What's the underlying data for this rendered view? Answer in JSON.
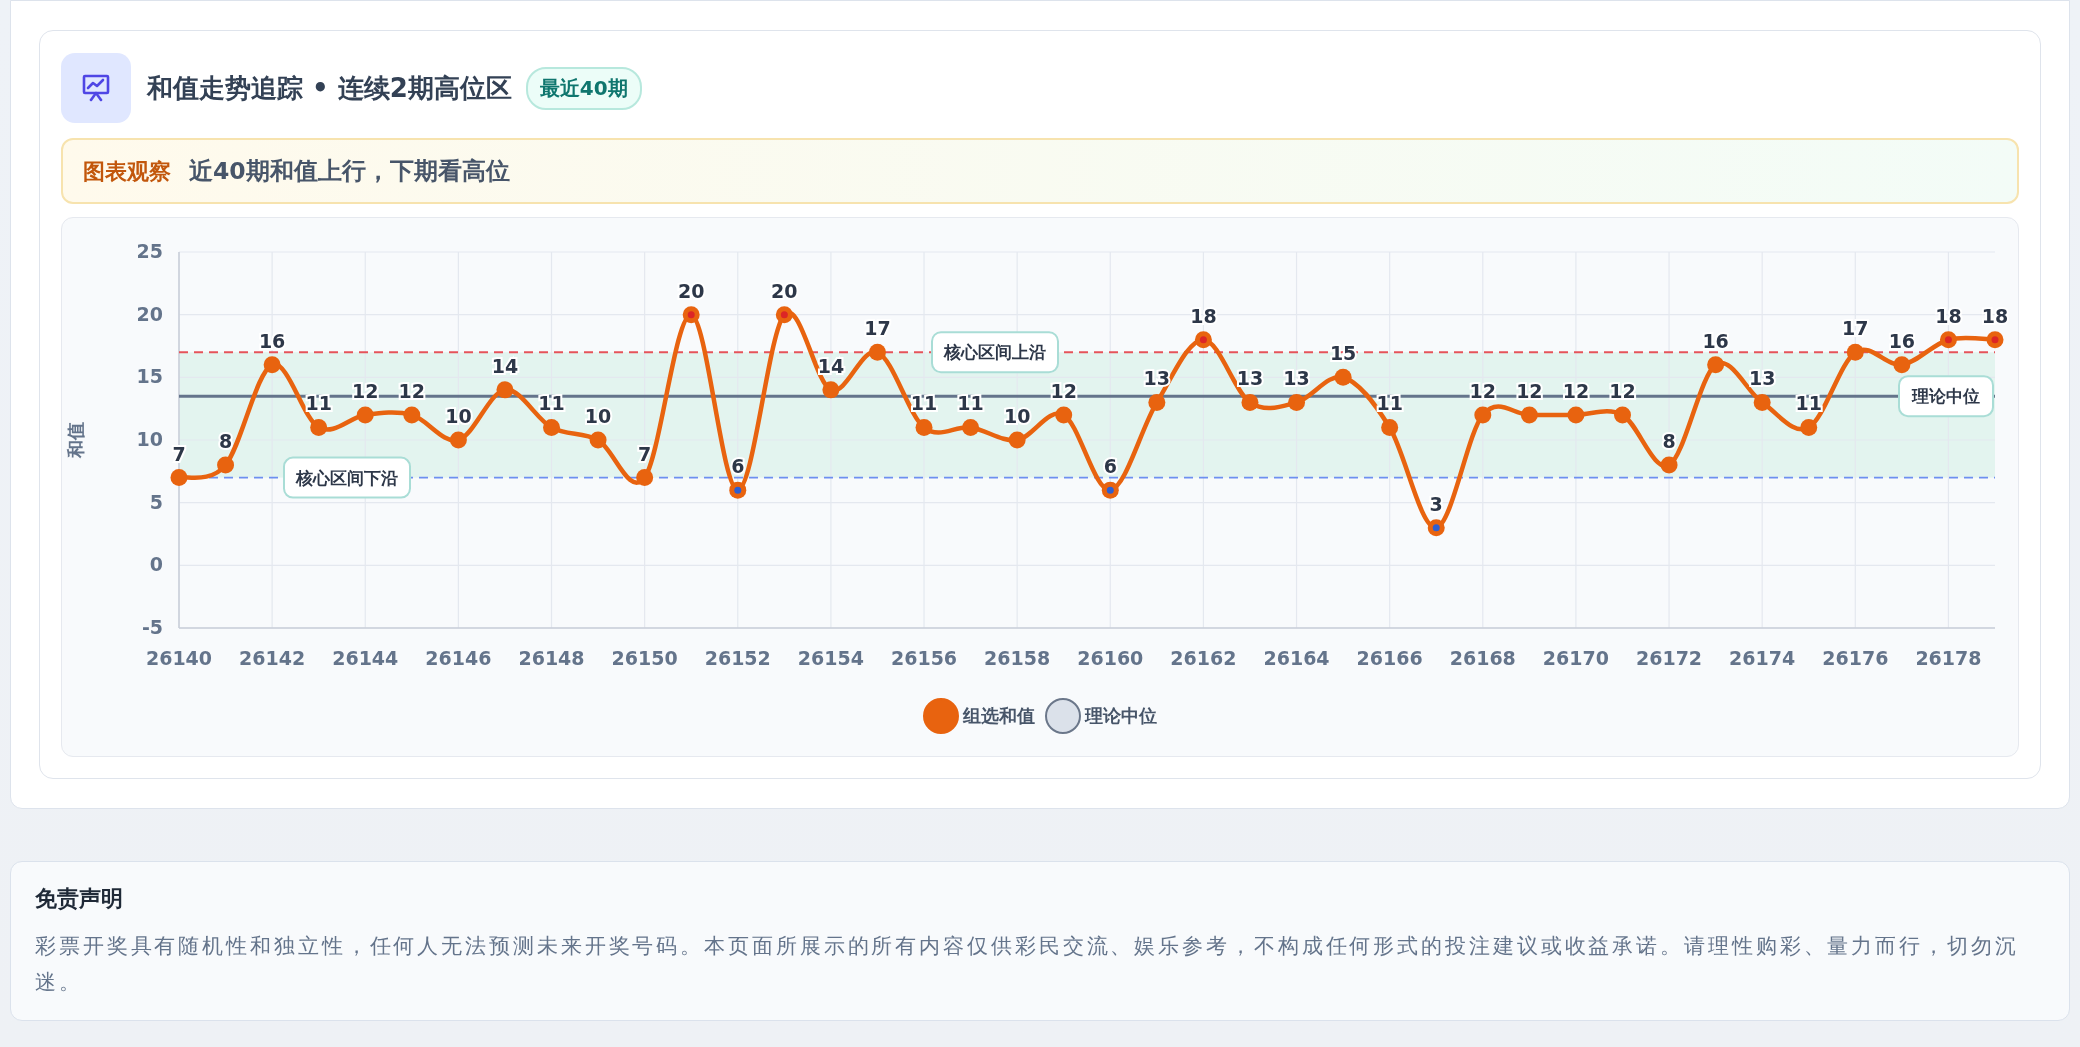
{
  "header": {
    "title": "和值走势追踪 • 连续2期高位区",
    "badge": "最近40期"
  },
  "insight": {
    "label": "图表观察",
    "text": "近40期和值上行，下期看高位"
  },
  "chart": {
    "chart_data": {
      "type": "line",
      "ylabel": "和值",
      "x": [
        26140,
        26141,
        26142,
        26143,
        26144,
        26145,
        26146,
        26147,
        26148,
        26149,
        26150,
        26151,
        26152,
        26153,
        26154,
        26155,
        26156,
        26157,
        26158,
        26159,
        26160,
        26161,
        26162,
        26163,
        26164,
        26165,
        26166,
        26167,
        26168,
        26169,
        26170,
        26171,
        26172,
        26173,
        26174,
        26175,
        26176,
        26177,
        26178,
        26179
      ],
      "xlim": [
        26140,
        26179
      ],
      "ylim": [
        -5,
        25
      ],
      "xticks": [
        26140,
        26142,
        26144,
        26146,
        26148,
        26150,
        26152,
        26154,
        26156,
        26158,
        26160,
        26162,
        26164,
        26166,
        26168,
        26170,
        26172,
        26174,
        26176,
        26178
      ],
      "yticks": [
        -5,
        0,
        5,
        10,
        15,
        20,
        25
      ],
      "grid": true,
      "series": [
        {
          "name": "组选和值",
          "color": "#e8630f",
          "marker": "o",
          "values": [
            7,
            8,
            16,
            11,
            12,
            12,
            10,
            14,
            11,
            10,
            7,
            20,
            6,
            20,
            14,
            17,
            11,
            11,
            10,
            12,
            6,
            13,
            18,
            13,
            13,
            15,
            11,
            3,
            12,
            12,
            12,
            12,
            8,
            16,
            13,
            11,
            17,
            16,
            18,
            18
          ]
        }
      ],
      "data_labels": true,
      "bands": [
        {
          "axis": "y",
          "from": 7,
          "to": 17,
          "color": "#e3f4ef"
        }
      ],
      "ref_lines": [
        {
          "axis": "y",
          "value": 17,
          "label": "核心区间上沿",
          "color": "#e5535a"
        },
        {
          "axis": "y",
          "value": 13.5,
          "label": "理论中位",
          "color": "#64748b"
        },
        {
          "axis": "y",
          "value": 7,
          "label": "核心区间下沿",
          "color": "#6d8ff0"
        }
      ]
    },
    "legend": [
      {
        "label": "理论中位",
        "color": "#dbe1ea"
      }
    ]
  },
  "disclaimer": {
    "title": "免责声明",
    "text": "彩票开奖具有随机性和独立性，任何人无法预测未来开奖号码。本页面所展示的所有内容仅供彩民交流、娱乐参考，不构成任何形式的投注建议或收益承诺。请理性购彩、量力而行，切勿沉迷。"
  }
}
